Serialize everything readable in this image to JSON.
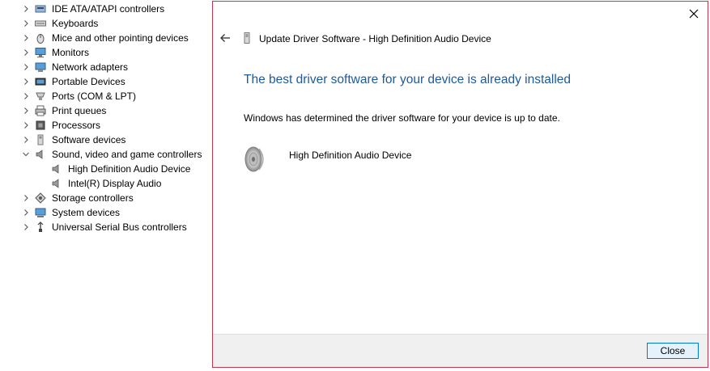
{
  "device_tree": {
    "items": [
      {
        "label": "IDE ATA/ATAPI controllers",
        "icon": "ide-controller-icon",
        "expanded": false
      },
      {
        "label": "Keyboards",
        "icon": "keyboard-icon",
        "expanded": false
      },
      {
        "label": "Mice and other pointing devices",
        "icon": "mouse-icon",
        "expanded": false
      },
      {
        "label": "Monitors",
        "icon": "monitor-icon",
        "expanded": false
      },
      {
        "label": "Network adapters",
        "icon": "network-adapter-icon",
        "expanded": false
      },
      {
        "label": "Portable Devices",
        "icon": "portable-device-icon",
        "expanded": false
      },
      {
        "label": "Ports (COM & LPT)",
        "icon": "port-icon",
        "expanded": false
      },
      {
        "label": "Print queues",
        "icon": "printer-icon",
        "expanded": false
      },
      {
        "label": "Processors",
        "icon": "processor-icon",
        "expanded": false
      },
      {
        "label": "Software devices",
        "icon": "software-device-icon",
        "expanded": false
      },
      {
        "label": "Sound, video and game controllers",
        "icon": "speaker-icon",
        "expanded": true
      },
      {
        "label": "High Definition Audio Device",
        "icon": "speaker-icon",
        "child": true
      },
      {
        "label": "Intel(R) Display Audio",
        "icon": "speaker-icon",
        "child": true
      },
      {
        "label": "Storage controllers",
        "icon": "storage-controller-icon",
        "expanded": false
      },
      {
        "label": "System devices",
        "icon": "system-device-icon",
        "expanded": false
      },
      {
        "label": "Universal Serial Bus controllers",
        "icon": "usb-icon",
        "expanded": false
      }
    ]
  },
  "dialog": {
    "title": "Update Driver Software - High Definition Audio Device",
    "headline": "The best driver software for your device is already installed",
    "message": "Windows has determined the driver software for your device is up to date.",
    "device_name": "High Definition Audio Device",
    "close_button_label": "Close",
    "border_color": "#c2354f",
    "headline_color": "#1c5a9e",
    "button_accent": "#0078d7"
  }
}
